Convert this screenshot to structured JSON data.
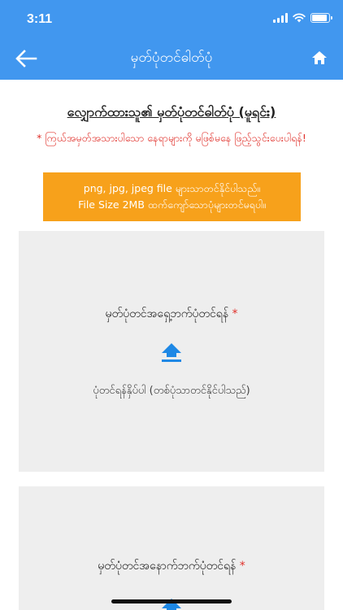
{
  "status": {
    "time": "3:11"
  },
  "appbar": {
    "title": "မှတ်ပုံတင်ဓါတ်ပုံ"
  },
  "page": {
    "heading": "လျှောက်ထားသူ၏ မှတ်ပုံတင်ဓါတ်ပုံ (မူရင်း)",
    "warning": "* ကြယ်အမှတ်အသားပါသော နေရာများကို မဖြစ်မနေ ဖြည့်သွင်းပေးပါရန်!",
    "notice_line1": "png, jpg, jpeg file များသာတင်နိုင်ပါသည်။",
    "notice_line2": "File Size 2MB ထက်ကျော်သောပုံများတင်မရပါ။"
  },
  "front_card": {
    "label": "မှတ်ပုံတင်အရှေ့ဘက်ပုံတင်ရန်",
    "required": "*",
    "hint": "ပုံတင်ရန်နှိပ်ပါ (တစ်ပုံသာတင်နိုင်ပါသည်)"
  },
  "back_card": {
    "label": "မှတ်ပုံတင်အနောက်ဘက်ပုံတင်ရန်",
    "required": "*"
  },
  "colors": {
    "primary": "#4197ef",
    "notice": "#f7a11b",
    "error": "#e0302a",
    "card": "#eeeeee"
  },
  "icons": [
    "back-arrow-icon",
    "home-icon",
    "upload-icon",
    "wifi-icon",
    "battery-icon",
    "signal-icon"
  ]
}
